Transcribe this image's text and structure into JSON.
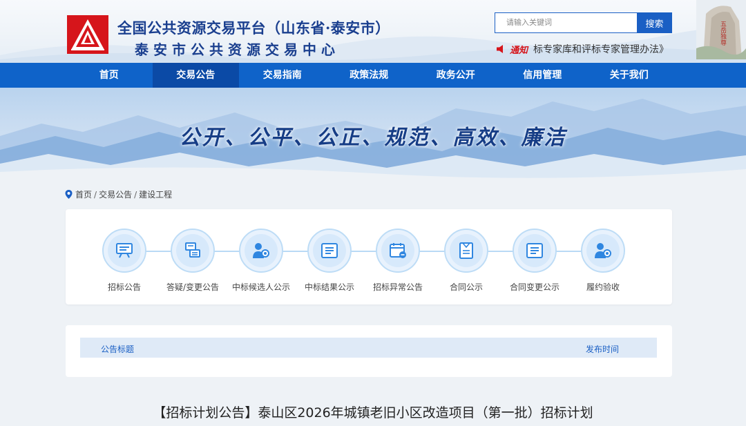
{
  "header": {
    "title_line1": "全国公共资源交易平台（山东省·泰安市）",
    "title_line2": "泰安市公共资源交易中心",
    "search_placeholder": "请输入关键词",
    "search_button": "搜索",
    "notice_tag": "通知",
    "notice_text": "标专家库和评标专家管理办法》",
    "monument_text": "五岳独尊"
  },
  "nav": {
    "items": [
      "首页",
      "交易公告",
      "交易指南",
      "政策法规",
      "政务公开",
      "信用管理",
      "关于我们"
    ],
    "active_index": 1
  },
  "banner": {
    "slogan": "公开、公平、公正、规范、高效、廉洁"
  },
  "breadcrumb": {
    "items": [
      "首页",
      "交易公告",
      "建设工程"
    ],
    "separator": "/"
  },
  "categories": [
    {
      "label": "招标公告",
      "icon": "presentation-board-icon"
    },
    {
      "label": "答疑/变更公告",
      "icon": "document-exchange-icon"
    },
    {
      "label": "中标候选人公示",
      "icon": "person-search-icon"
    },
    {
      "label": "中标结果公示",
      "icon": "list-document-icon"
    },
    {
      "label": "招标异常公告",
      "icon": "calendar-warning-icon"
    },
    {
      "label": "合同公示",
      "icon": "contract-document-icon"
    },
    {
      "label": "合同变更公示",
      "icon": "list-document-icon"
    },
    {
      "label": "履约验收",
      "icon": "person-search-icon"
    }
  ],
  "table": {
    "col_title": "公告标题",
    "col_time": "发布时间"
  },
  "article": {
    "title": "【招标计划公告】泰山区2026年城镇老旧小区改造项目（第一批）招标计划"
  },
  "colors": {
    "primary": "#0f63c9",
    "nav_active": "#0b4aa6",
    "title_blue": "#1a3f8f",
    "logo_red": "#d6151b"
  }
}
